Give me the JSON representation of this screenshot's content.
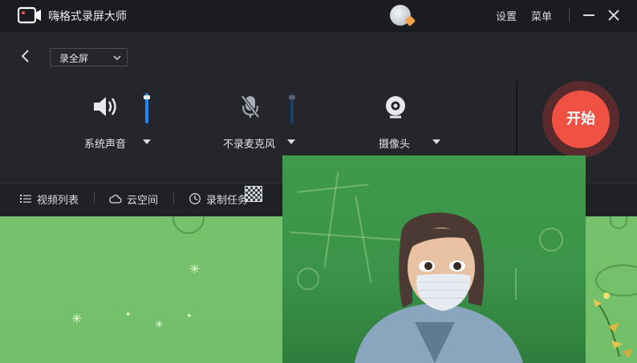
{
  "app": {
    "title": "嗨格式录屏大师",
    "settings_label": "设置",
    "menu_label": "菜单",
    "minimize_icon": "minimize-icon",
    "close_icon": "close-icon"
  },
  "record_mode": {
    "selected": "录全屏"
  },
  "sources": {
    "system_audio": {
      "label": "系统声音",
      "icon": "speaker-icon",
      "level": 1.0,
      "enabled": true
    },
    "microphone": {
      "label": "不录麦克风",
      "icon": "microphone-muted-icon",
      "level": 1.0,
      "enabled": false
    },
    "camera": {
      "label": "摄像头",
      "icon": "webcam-icon",
      "enabled": true
    }
  },
  "start_button": {
    "label": "开始"
  },
  "bottom_bar": {
    "items": [
      {
        "label": "视频列表",
        "icon": "list-icon"
      },
      {
        "label": "云空间",
        "icon": "cloud-icon"
      },
      {
        "label": "录制任务",
        "icon": "clock-icon"
      }
    ]
  },
  "colors": {
    "accent": "#f05143",
    "slider_active": "#1a8cff",
    "slider_inactive": "#1e3e66",
    "window_bg": "#24262c",
    "titlebar_bg": "#1b1c21",
    "desktop_bg": "#76c06c"
  }
}
